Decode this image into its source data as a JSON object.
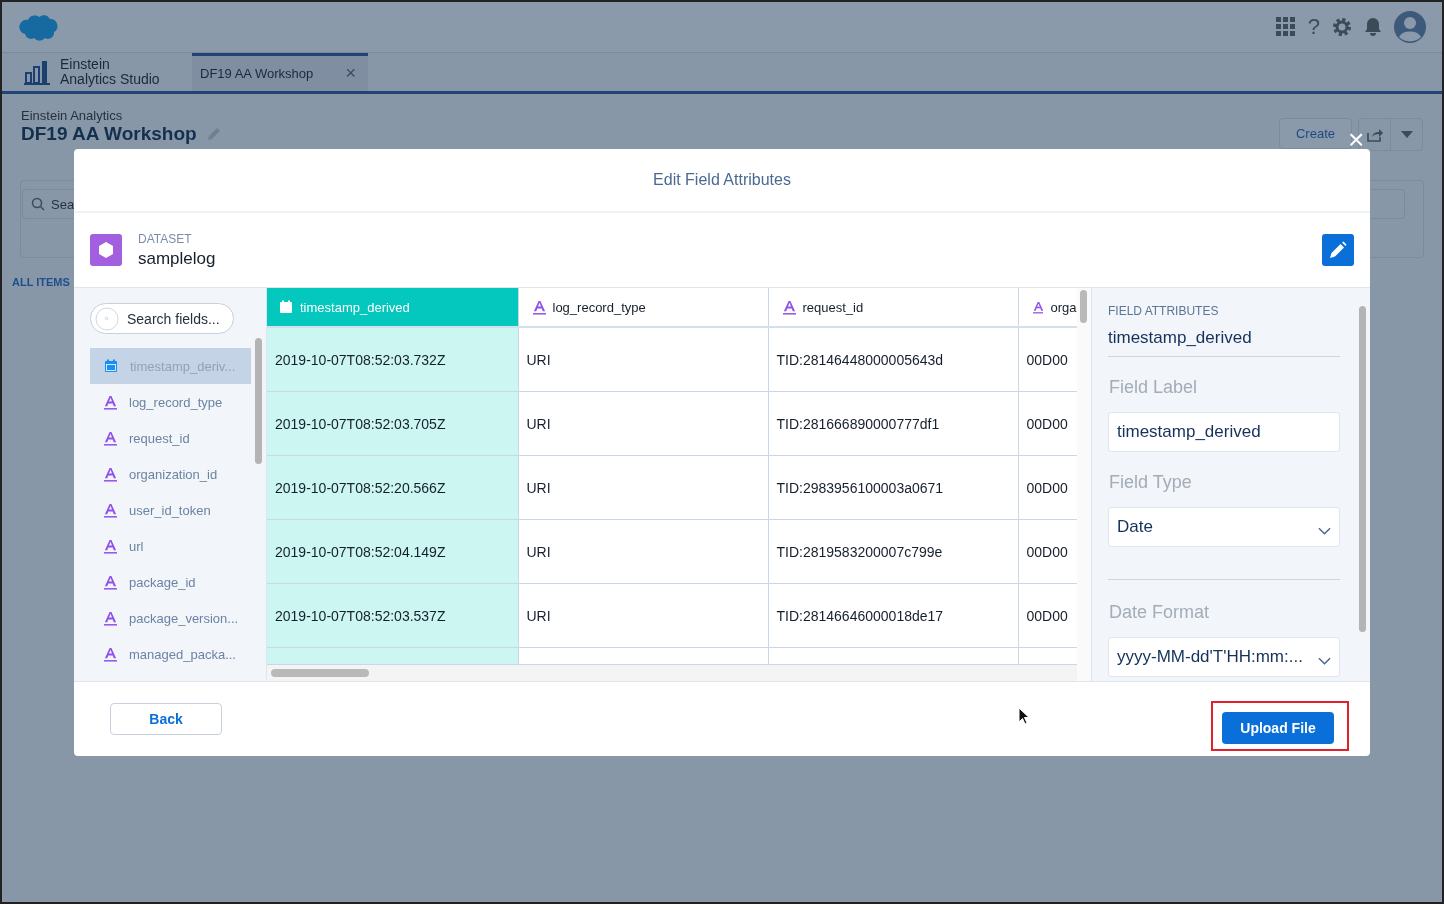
{
  "top_bar": {
    "help_label": "?"
  },
  "app_tabs": [
    {
      "label": "Einstein\nAnalytics Studio",
      "kind": "app"
    },
    {
      "label": "DF19 AA Workshop",
      "kind": "tab",
      "selected": true,
      "close": "×"
    }
  ],
  "page_header": {
    "subtitle": "Einstein Analytics",
    "title": "DF19 AA Workshop",
    "create": "Create",
    "search_placeholder": "Sea",
    "all_items": "ALL ITEMS"
  },
  "modal": {
    "close": "×",
    "title": "Edit Field Attributes",
    "dataset_label": "DATASET",
    "dataset_name": "samplelog",
    "search_placeholder": "Search fields...",
    "fields": [
      {
        "name": "timestamp_deriv...",
        "kind": "date",
        "selected": true
      },
      {
        "name": "log_record_type",
        "kind": "text",
        "selected": false
      },
      {
        "name": "request_id",
        "kind": "text",
        "selected": false
      },
      {
        "name": "organization_id",
        "kind": "text",
        "selected": false
      },
      {
        "name": "user_id_token",
        "kind": "text",
        "selected": false
      },
      {
        "name": "url",
        "kind": "text",
        "selected": false
      },
      {
        "name": "package_id",
        "kind": "text",
        "selected": false
      },
      {
        "name": "package_version...",
        "kind": "text",
        "selected": false
      },
      {
        "name": "managed_packa...",
        "kind": "text",
        "selected": false
      }
    ],
    "table": {
      "columns": [
        {
          "label": "timestamp_derived",
          "kind": "date",
          "selected": true
        },
        {
          "label": "log_record_type",
          "kind": "text",
          "selected": false
        },
        {
          "label": "request_id",
          "kind": "text",
          "selected": false
        },
        {
          "label": "orga",
          "kind": "text",
          "selected": false
        }
      ],
      "rows": [
        [
          "2019-10-07T08:52:03.732Z",
          "URI",
          "TID:28146448000005643d",
          "00D00"
        ],
        [
          "2019-10-07T08:52:03.705Z",
          "URI",
          "TID:281666890000777df1",
          "00D00"
        ],
        [
          "2019-10-07T08:52:20.566Z",
          "URI",
          "TID:2983956100003a0671",
          "00D00"
        ],
        [
          "2019-10-07T08:52:04.149Z",
          "URI",
          "TID:2819583200007c799e",
          "00D00"
        ],
        [
          "2019-10-07T08:52:03.537Z",
          "URI",
          "TID:28146646000018de17",
          "00D00"
        ]
      ]
    },
    "attributes": {
      "heading": "FIELD ATTRIBUTES",
      "field": "timestamp_derived",
      "label_caption": "Field Label",
      "label_value": "timestamp_derived",
      "type_caption": "Field Type",
      "type_value": "Date",
      "format_caption": "Date Format",
      "format_value": "yyyy-MM-dd'T'HH:mm:..."
    },
    "back": "Back",
    "upload": "Upload File",
    "upload_highlighted": true
  }
}
